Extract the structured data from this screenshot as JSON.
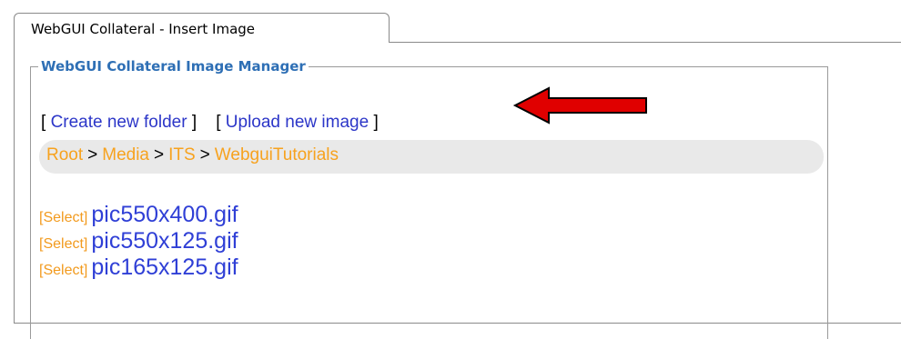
{
  "tab": {
    "title": "WebGUI Collateral - Insert Image"
  },
  "manager": {
    "legend": "WebGUI Collateral Image Manager"
  },
  "actions": {
    "open_bracket": "[",
    "close_bracket": "]",
    "create_folder": "Create new folder",
    "upload_image": "Upload new image"
  },
  "breadcrumb": {
    "separator": ">",
    "items": [
      "Root",
      "Media",
      "ITS",
      "WebguiTutorials"
    ]
  },
  "files": [
    {
      "select": "[Select]",
      "name": "pic550x400.gif"
    },
    {
      "select": "[Select]",
      "name": "pic550x125.gif"
    },
    {
      "select": "[Select]",
      "name": "pic165x125.gif"
    }
  ],
  "annotation": {
    "arrow_icon": "red-left-arrow",
    "arrow_color": "#e00000"
  }
}
